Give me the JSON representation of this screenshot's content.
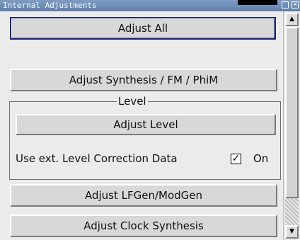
{
  "window": {
    "title": "Internal Adjustments"
  },
  "buttons": {
    "adjust_all": "Adjust All",
    "adjust_synthesis": "Adjust Synthesis / FM / PhiM",
    "adjust_level": "Adjust Level",
    "adjust_lfgen": "Adjust LFGen/ModGen",
    "adjust_clock": "Adjust Clock Synthesis"
  },
  "level_group": {
    "legend": "Level",
    "correction_label": "Use ext. Level Correction Data",
    "checkbox_checked": true,
    "checkbox_mark": "✓",
    "checkbox_label": "On"
  },
  "icons": {
    "maximize": "maximize-icon",
    "close": "close-icon",
    "scroll_up": "arrow-up-icon",
    "scroll_down": "arrow-down-icon"
  }
}
